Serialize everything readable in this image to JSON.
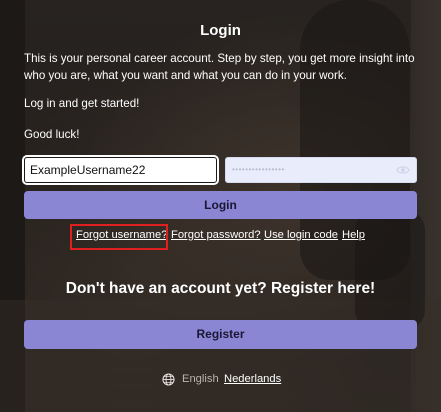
{
  "login": {
    "title": "Login",
    "intro": "This is your personal career account. Step by step, you get more insight into who you are, what you want and what you can do in your work.",
    "get_started": "Log in and get started!",
    "good_luck": "Good luck!",
    "username_value": "ExampleUsername22",
    "password_mask": "••••••••••••••••",
    "login_button": "Login"
  },
  "links": {
    "forgot_username": "Forgot username?",
    "forgot_password": "Forgot password?",
    "use_login_code": "Use login code",
    "help": "Help"
  },
  "register": {
    "heading": "Don't have an account yet? Register here!",
    "button": "Register"
  },
  "language": {
    "current": "English",
    "alternative": "Nederlands",
    "icon": "globe-icon"
  },
  "colors": {
    "button": "#8b86d4",
    "highlight": "#e02020",
    "password_field": "#e9ecfb"
  }
}
